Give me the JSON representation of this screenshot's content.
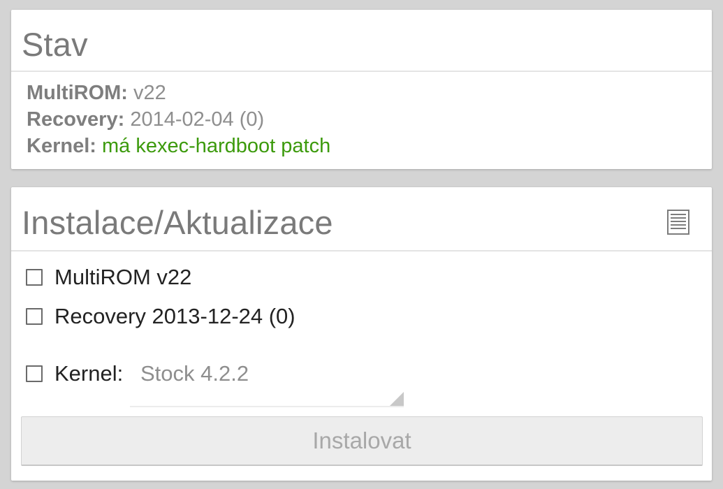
{
  "status_card": {
    "title": "Stav",
    "multirom_key": "MultiROM:",
    "multirom_value": "v22",
    "recovery_key": "Recovery:",
    "recovery_value": "2014-02-04 (0)",
    "kernel_key": "Kernel:",
    "kernel_value": "má kexec-hardboot patch",
    "kernel_value_color": "#3c9a0c"
  },
  "install_card": {
    "title": "Instalace/Aktualizace",
    "changelog_icon": "changelog-icon",
    "options": [
      {
        "label": "MultiROM v22",
        "checked": false
      },
      {
        "label": "Recovery 2013-12-24 (0)",
        "checked": false
      }
    ],
    "kernel_option": {
      "label": "Kernel:",
      "checked": false,
      "selected_value": "Stock 4.2.2"
    },
    "install_button_label": "Instalovat",
    "install_button_enabled": false
  }
}
